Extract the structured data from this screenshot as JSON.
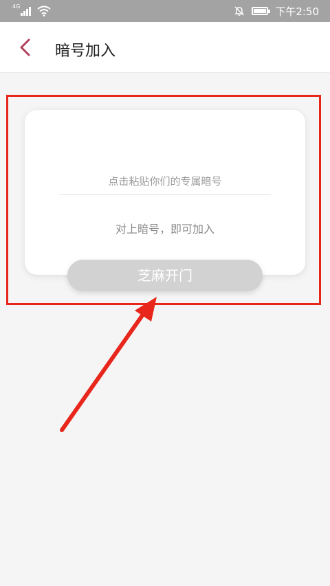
{
  "status_bar": {
    "network": "4G",
    "time": "下午2:50",
    "battery_level": 0.9,
    "icons": [
      "signal-icon",
      "wifi-icon",
      "notifications-off-icon",
      "battery-icon"
    ]
  },
  "header": {
    "back_icon": "chevron-left-icon",
    "title": "暗号加入"
  },
  "card": {
    "input_placeholder": "点击粘贴你们的专属暗号",
    "input_value": "",
    "hint": "对上暗号，即可加入"
  },
  "actions": {
    "open_label": "芝麻开门"
  },
  "annotation": {
    "color": "#e8261b"
  },
  "colors": {
    "status_bar": "#a3a3a3",
    "back_icon": "#b0405c",
    "button_disabled": "#d2d2d2",
    "background": "#f5f5f5"
  }
}
